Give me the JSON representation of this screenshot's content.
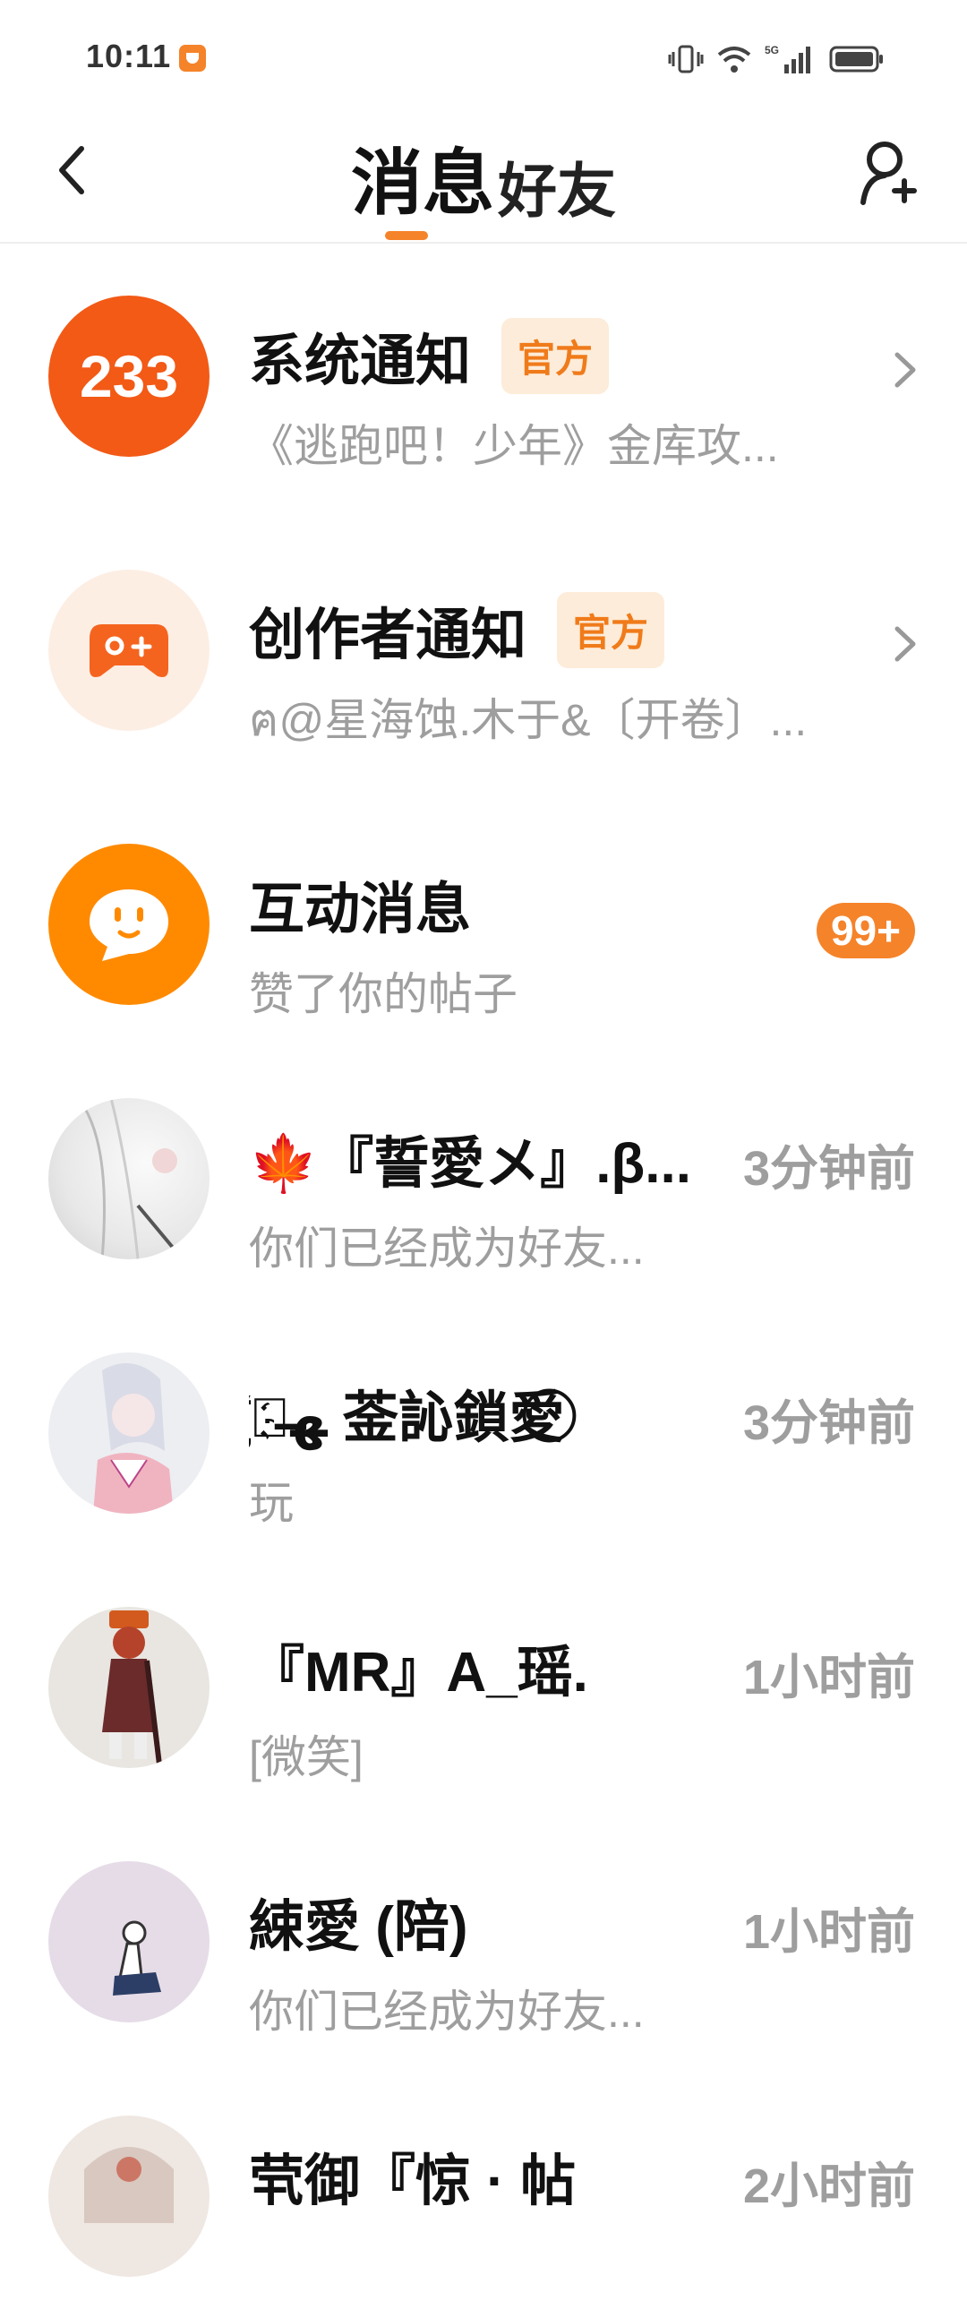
{
  "status_bar": {
    "time": "10:11",
    "network": "5G"
  },
  "header": {
    "tabs": [
      {
        "label": "消息",
        "active": true
      },
      {
        "label": "好友",
        "active": false
      }
    ],
    "accent_color": "#f5832a"
  },
  "messages": [
    {
      "title": "系统通知",
      "badge": "官方",
      "subtitle": "《逃跑吧！少年》金库攻...",
      "avatar_text": "233",
      "avatar_color": "#f25a16"
    },
    {
      "title": "创作者通知",
      "badge": "官方",
      "subtitle": "ฅ@星海蚀.木于&〔开卷〕...",
      "avatar_color": "#fdeee4"
    },
    {
      "title": "互动消息",
      "subtitle": "赞了你的帖子",
      "count": "99+",
      "avatar_color": "#ff8a00"
    },
    {
      "title": "🍁『誓愛メ』.β...",
      "subtitle": "你们已经成为好友...",
      "time": "3分钟前"
    },
    {
      "title": "ﻬ҉⃝̶ 菳訫鎖愛 ⃝",
      "subtitle": "玩",
      "time": "3分钟前"
    },
    {
      "title": "『MR』A_瑶.",
      "subtitle": "[微笑]",
      "time": "1小时前"
    },
    {
      "title": "綀愛 (陪)",
      "subtitle": "你们已经成为好友...",
      "time": "1小时前"
    },
    {
      "title": "茕御『惊 · 帖",
      "subtitle": "",
      "time": "2小时前"
    }
  ]
}
